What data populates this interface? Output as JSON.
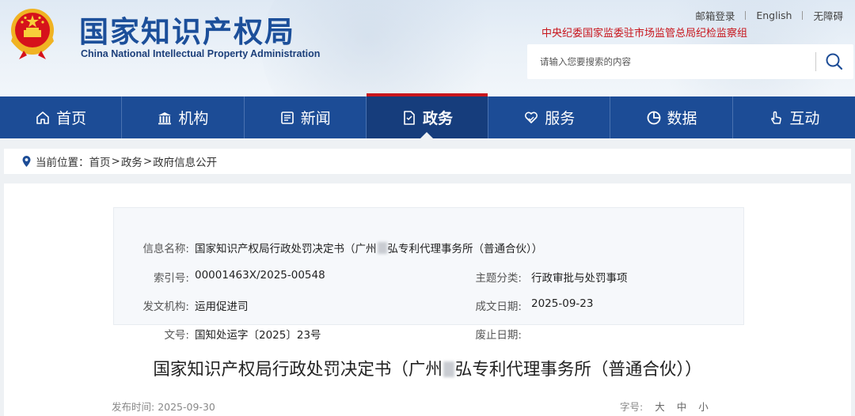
{
  "header": {
    "title_cn": "国家知识产权局",
    "title_en": "China National Intellectual Property Administration",
    "top_links": [
      "邮箱登录",
      "English",
      "无障碍"
    ],
    "notice": "中央纪委国家监委驻市场监管总局纪检监察组",
    "search_placeholder": "请输入您要搜索的内容"
  },
  "nav": {
    "items": [
      {
        "label": "首页",
        "icon": "home-icon"
      },
      {
        "label": "机构",
        "icon": "building-icon"
      },
      {
        "label": "新闻",
        "icon": "newspaper-icon"
      },
      {
        "label": "政务",
        "icon": "document-icon",
        "active": true
      },
      {
        "label": "服务",
        "icon": "heart-hand-icon"
      },
      {
        "label": "数据",
        "icon": "pie-chart-icon"
      },
      {
        "label": "互动",
        "icon": "pointer-hand-icon"
      }
    ]
  },
  "breadcrumb": {
    "prefix": "当前位置：",
    "items": [
      "首页",
      "政务",
      "政府信息公开"
    ],
    "separator": ">"
  },
  "meta": {
    "info_name_label": "信息名称:",
    "info_name_before": "国家知识产权局行政处罚决定书（广州",
    "info_name_after": "弘专利代理事务所（普通合伙））",
    "index_label": "索引号:",
    "index_value": "00001463X/2025-00548",
    "topic_label": "主题分类:",
    "topic_value": "行政审批与处罚事项",
    "issuer_label": "发文机构:",
    "issuer_value": "运用促进司",
    "date_label": "成文日期:",
    "date_value": "2025-09-23",
    "docno_label": "文号:",
    "docno_value": "国知处运字〔2025〕23号",
    "abolish_label": "废止日期:",
    "abolish_value": ""
  },
  "document": {
    "title_before": "国家知识产权局行政处罚决定书（广州",
    "title_after": "弘专利代理事务所（普通合伙））",
    "publish_label": "发布时间:",
    "publish_date": "2025-09-30",
    "font_size_label": "字号:",
    "font_size_options": [
      "大",
      "中",
      "小"
    ]
  },
  "colors": {
    "nav_bg": "#1c4c96",
    "nav_active": "#163d7c",
    "accent_red": "#c8161d",
    "title_blue": "#1c4f9a"
  }
}
